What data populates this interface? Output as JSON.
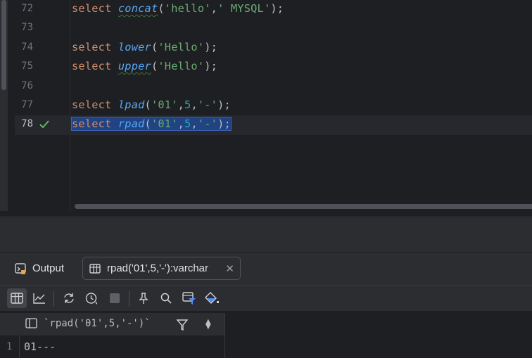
{
  "editor": {
    "lines": [
      {
        "num": "72",
        "top": 0
      },
      {
        "num": "73"
      },
      {
        "num": "74"
      },
      {
        "num": "75"
      },
      {
        "num": "76"
      },
      {
        "num": "77"
      },
      {
        "num": "78"
      }
    ],
    "tokens": {
      "select": "select",
      "concat": "concat",
      "concat_args": "('hello',' MYSQL');",
      "lower": "lower",
      "upper": "upper",
      "hello_arg": "('Hello');",
      "lpad": "lpad",
      "rpad": "rpad",
      "paren_open": "(",
      "str_01": "'01'",
      "comma": ",",
      "num_5": "5",
      "str_dash": "'-'",
      "paren_close": ");"
    }
  },
  "panel": {
    "tabs": {
      "output_label": "Output",
      "result_label": "rpad('01',5,'-'):varchar",
      "close_glyph": "✕"
    },
    "grid": {
      "column_name": "`rpad('01',5,'-')`",
      "sort_glyph": "⬆⬇",
      "rows": [
        {
          "num": "1",
          "value": "01---"
        }
      ]
    }
  },
  "colors": {
    "keyword": "#cf8e6d",
    "function": "#56a8f5",
    "string": "#6aab73",
    "number": "#2aacb8",
    "selection": "#214283",
    "success": "#5fb865"
  },
  "icons": [
    "check-icon",
    "output-icon",
    "table-icon",
    "chart-icon",
    "refresh-icon",
    "history-icon",
    "stop-icon",
    "pin-icon",
    "search-icon",
    "filter-icon",
    "paint-bucket-icon",
    "sort-icon"
  ]
}
